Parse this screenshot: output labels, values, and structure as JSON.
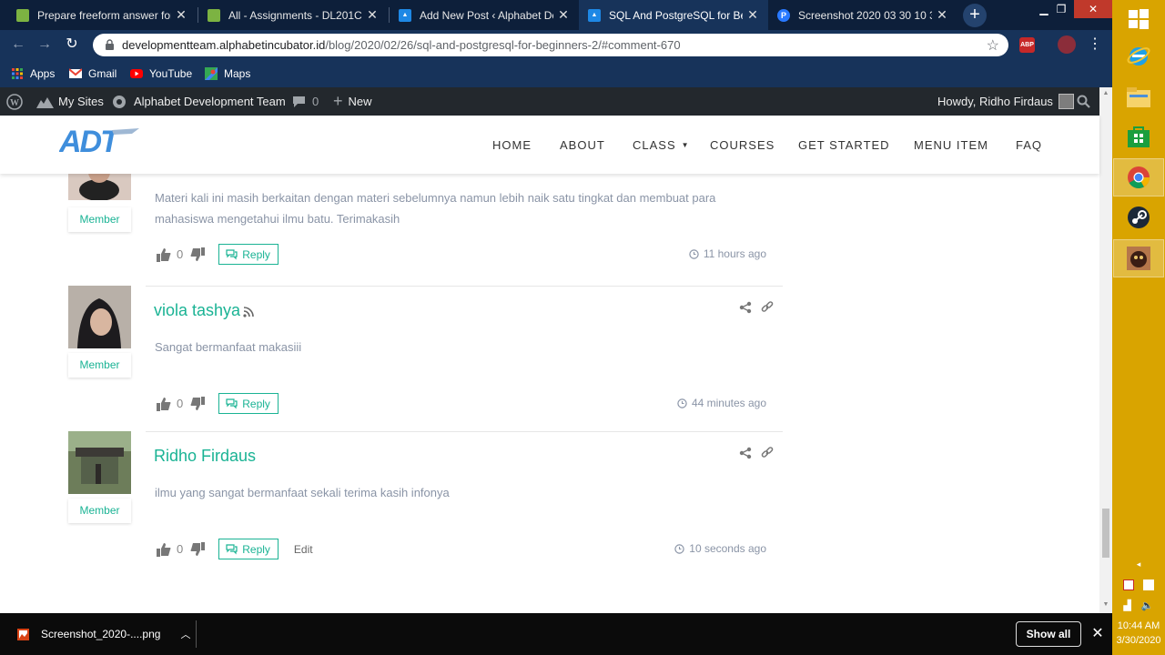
{
  "browser": {
    "tabs": [
      {
        "title": "Prepare freeform answer for A",
        "icon_color": "#7cb342"
      },
      {
        "title": "All - Assignments - DL201C - S",
        "icon_color": "#7cb342"
      },
      {
        "title": "Add New Post ‹ Alphabet Dev",
        "icon_color": "#1e88e5"
      },
      {
        "title": "SQL And PostgreSQL for Begin",
        "icon_color": "#1e88e5"
      },
      {
        "title": "Screenshot 2020 03 30 10 39",
        "icon_color": "#2979ff"
      }
    ],
    "active_tab_index": 3,
    "url_host": "developmentteam.alphabetincubator.id",
    "url_path": "/blog/2020/02/26/sql-and-postgresql-for-beginners-2/#comment-670",
    "bookmarks": [
      "Apps",
      "Gmail",
      "YouTube",
      "Maps"
    ]
  },
  "adminbar": {
    "my_sites": "My Sites",
    "site_name": "Alphabet Development Team",
    "comments_count": "0",
    "new_label": "New",
    "howdy": "Howdy, Ridho Firdaus"
  },
  "site": {
    "logo_text": "ADT",
    "menu": [
      "HOME",
      "ABOUT",
      "CLASS",
      "COURSES",
      "GET STARTED",
      "MENU ITEM",
      "FAQ"
    ]
  },
  "comments": [
    {
      "name": "",
      "role": "Member",
      "text": "Materi kali ini masih berkaitan dengan materi sebelumnya namun lebih naik satu tingkat dan membuat para mahasiswa mengetahui ilmu batu. Terimakasih",
      "votes": "0",
      "reply": "Reply",
      "time": "11 hours ago"
    },
    {
      "name": "viola tashya",
      "role": "Member",
      "text": "Sangat bermanfaat makasiii",
      "votes": "0",
      "reply": "Reply",
      "time": "44 minutes ago"
    },
    {
      "name": "Ridho Firdaus",
      "role": "Member",
      "text": "ilmu yang sangat bermanfaat sekali terima kasih infonya",
      "votes": "0",
      "reply": "Reply",
      "edit": "Edit",
      "time": "10 seconds ago"
    }
  ],
  "download": {
    "file": "Screenshot_2020-....png",
    "show_all": "Show all"
  },
  "taskbar": {
    "time": "10:44 AM",
    "date": "3/30/2020"
  },
  "colors": {
    "accent": "#1ab394",
    "tabstrip": "#0d1f3a",
    "toolbar": "#17335a",
    "adminbar": "#23282d",
    "taskbar": "#d9a400"
  }
}
